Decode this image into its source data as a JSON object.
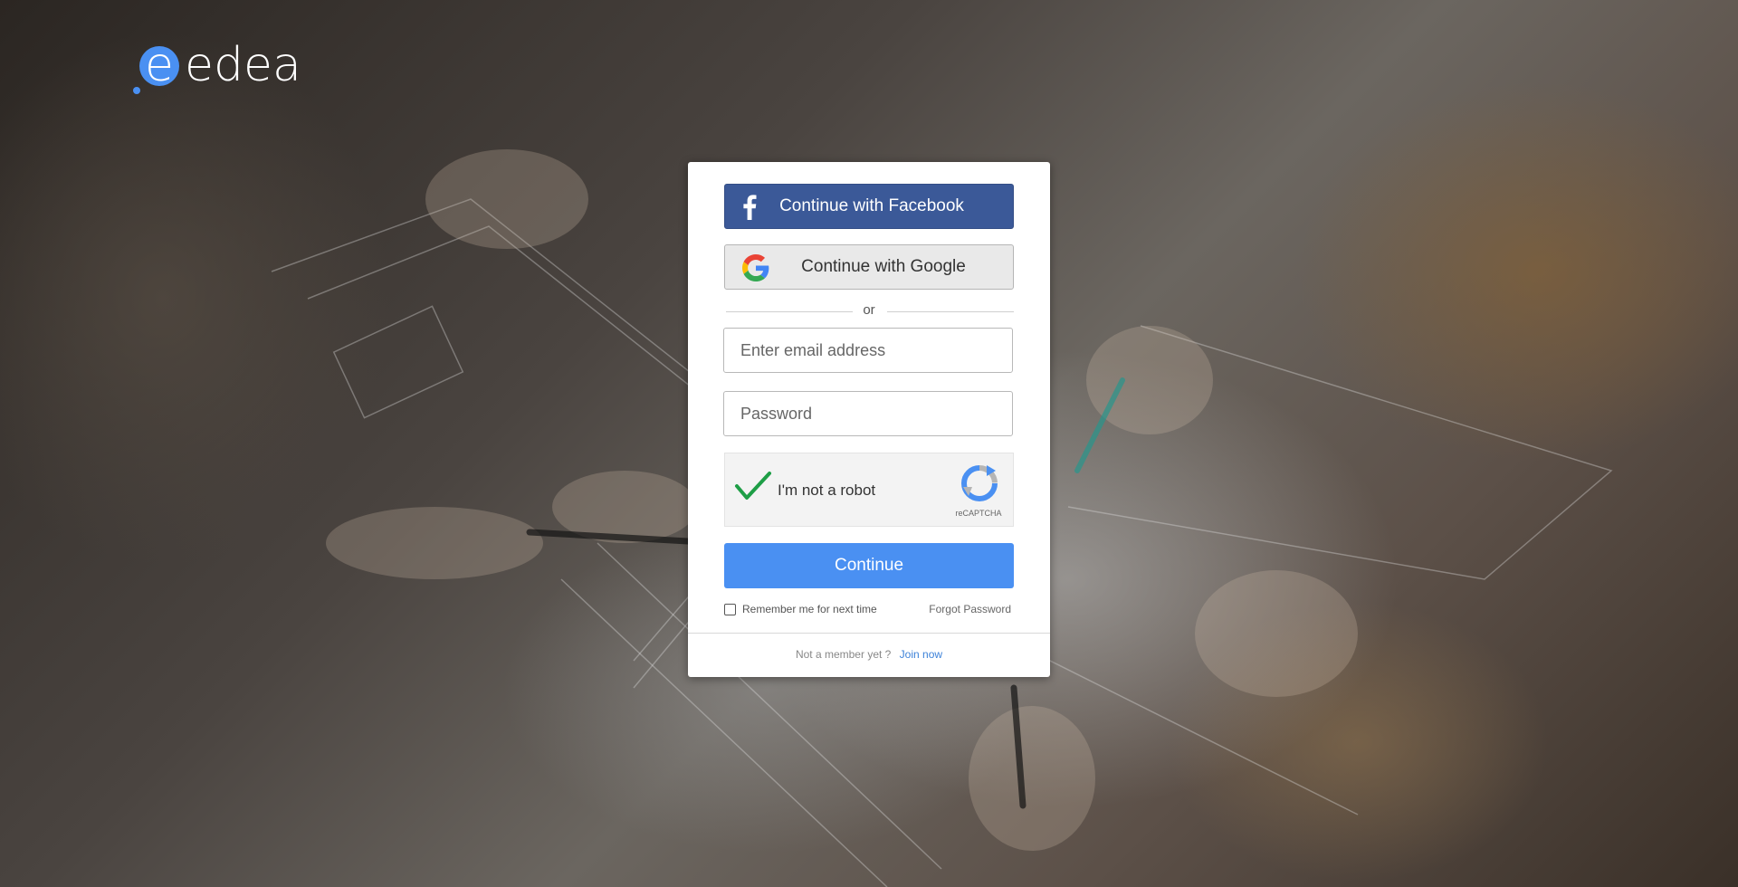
{
  "brand": {
    "logo_text": "edea",
    "logo_color": "#ffffff",
    "accent": "#4a90f2"
  },
  "social": {
    "facebook_label": "Continue with Facebook",
    "facebook_icon": "facebook-icon",
    "facebook_color": "#3b5998",
    "google_label": "Continue with Google",
    "google_icon": "google-icon"
  },
  "divider": {
    "text": "or"
  },
  "form": {
    "email_placeholder": "Enter email address",
    "email_value": "",
    "password_placeholder": "Password",
    "password_value": ""
  },
  "captcha": {
    "label": "I'm not a robot",
    "checked": true,
    "brand_text": "reCAPTCHA",
    "check_icon": "checkmark-icon",
    "logo_icon": "recaptcha-icon"
  },
  "actions": {
    "continue_label": "Continue",
    "remember_label": "Remember me for next time",
    "remember_checked": false,
    "forgot_label": "Forgot Password"
  },
  "footer": {
    "prompt": "Not a member yet ?",
    "join_label": "Join now"
  }
}
